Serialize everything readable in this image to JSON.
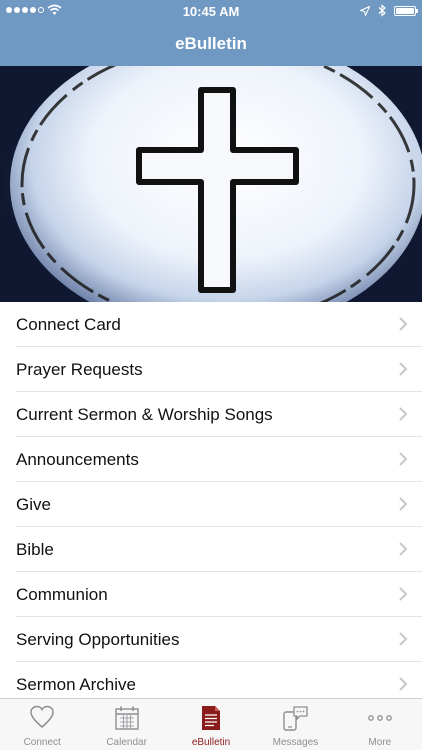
{
  "status_bar": {
    "time": "10:45 AM"
  },
  "nav": {
    "title": "eBulletin"
  },
  "menu": {
    "items": [
      {
        "label": "Connect Card"
      },
      {
        "label": "Prayer Requests"
      },
      {
        "label": "Current Sermon & Worship Songs"
      },
      {
        "label": "Announcements"
      },
      {
        "label": "Give"
      },
      {
        "label": "Bible"
      },
      {
        "label": "Communion"
      },
      {
        "label": "Serving Opportunities"
      },
      {
        "label": "Sermon Archive"
      }
    ]
  },
  "tabbar": {
    "tabs": [
      {
        "label": "Connect",
        "icon": "heart-icon"
      },
      {
        "label": "Calendar",
        "icon": "calendar-icon"
      },
      {
        "label": "eBulletin",
        "icon": "document-icon",
        "active": true
      },
      {
        "label": "Messages",
        "icon": "messages-icon"
      },
      {
        "label": "More",
        "icon": "more-icon"
      }
    ]
  },
  "colors": {
    "header": "#6f98c2",
    "active_tab": "#8b1c1c",
    "inactive_tab": "#8e8e93",
    "divider": "#e3e3e6"
  }
}
